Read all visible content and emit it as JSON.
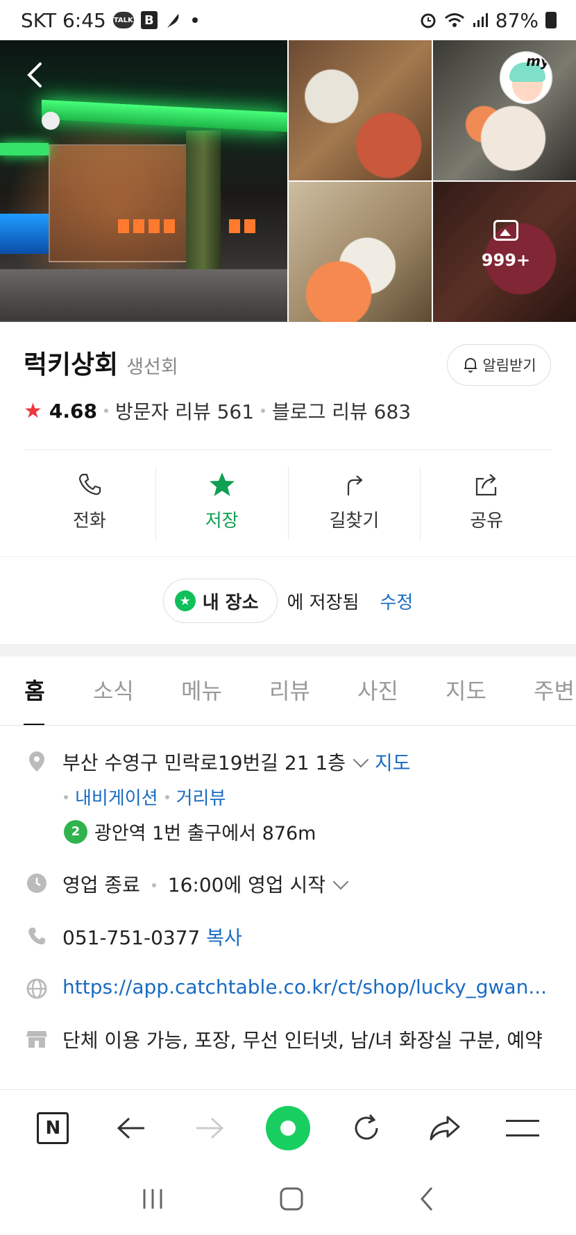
{
  "status_bar": {
    "carrier_time": "SKT 6:45",
    "talk_badge": "TALK",
    "b_badge": "B",
    "battery": "87%"
  },
  "photos": {
    "more_count": "999+"
  },
  "avatar": {
    "label": "my"
  },
  "place": {
    "name": "럭키상회",
    "category": "생선회",
    "notify_label": "알림받기",
    "rating_star": "★",
    "rating": "4.68",
    "visitor_reviews": "방문자 리뷰 561",
    "blog_reviews": "블로그 리뷰 683"
  },
  "actions": [
    {
      "label": "전화",
      "icon": "phone-icon"
    },
    {
      "label": "저장",
      "icon": "star-icon"
    },
    {
      "label": "길찾기",
      "icon": "directions-icon"
    },
    {
      "label": "공유",
      "icon": "share-icon"
    }
  ],
  "saved": {
    "chip_label": "내 장소",
    "suffix": "에 저장됨",
    "edit_label": "수정"
  },
  "tabs": [
    "홈",
    "소식",
    "메뉴",
    "리뷰",
    "사진",
    "지도",
    "주변"
  ],
  "info": {
    "address": "부산 수영구 민락로19번길 21 1층",
    "map_link": "지도",
    "navigation_link": "내비게이션",
    "streetview_link": "거리뷰",
    "subway_line": "2",
    "subway_text": "광안역 1번 출구에서 876m",
    "hours_status": "영업 종료",
    "hours_next": "16:00에 영업 시작",
    "phone": "051-751-0377",
    "copy_link": "복사",
    "website": "https://app.catchtable.co.kr/ct/shop/lucky_gwan...",
    "amenities": "단체 이용 가능, 포장, 무선 인터넷, 남/녀 화장실 구분, 예약"
  },
  "colors": {
    "accent_green": "#0fa052",
    "link_blue": "#1a6bc2",
    "rating_red": "#f0353b"
  }
}
